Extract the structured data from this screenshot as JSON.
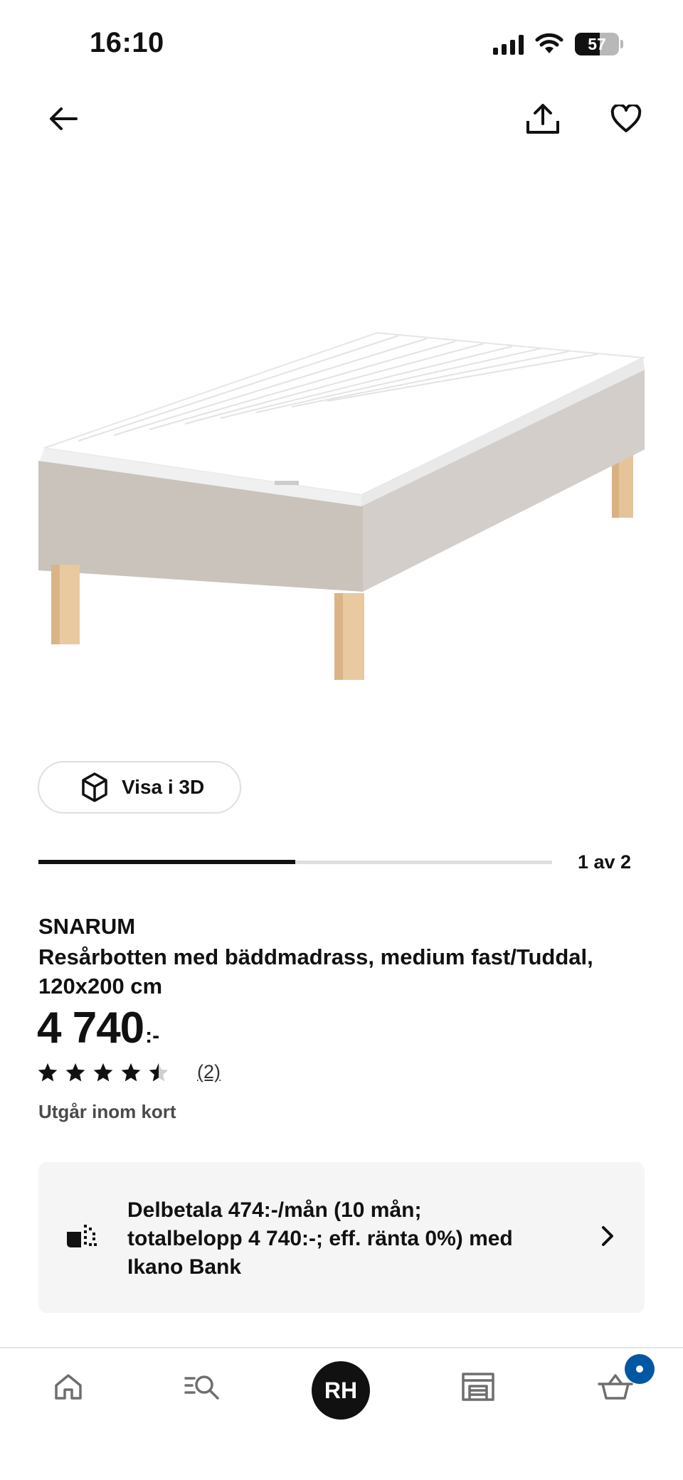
{
  "status_bar": {
    "time": "16:10",
    "battery": "57"
  },
  "product": {
    "name": "SNARUM",
    "description": "Resårbotten med bäddmadrass, medium fast/Tuddal, 120x200 cm",
    "price": "4 740",
    "price_suffix": ":-",
    "rating": 4.5,
    "review_count": "(2)",
    "availability": "Utgår inom kort"
  },
  "media": {
    "view_3d_label": "Visa i 3D",
    "carousel_counter": "1 av 2",
    "carousel_progress": 0.5
  },
  "payment": {
    "text": "Delbetala 474:-/mån (10 mån; totalbelopp 4 740:-; eff. ränta 0%) med Ikano Bank"
  },
  "bottom_nav": {
    "profile_initials": "RH",
    "cart_badge_color": "#0058a3"
  },
  "icons": {
    "back": "arrow-left-icon",
    "share": "share-icon",
    "favorite": "heart-icon",
    "cube": "cube-icon",
    "payment": "payment-icon",
    "chevron": "chevron-right-icon",
    "home": "home-icon",
    "search": "search-icon",
    "store": "store-icon",
    "cart": "cart-icon"
  }
}
